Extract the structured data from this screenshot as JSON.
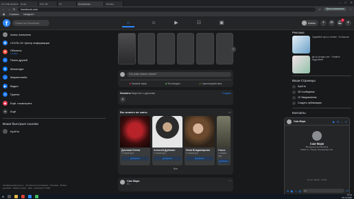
{
  "browser": {
    "tabs": [
      "(17) Vdik Facebook",
      "Gmail",
      "ГОС VIP",
      "VK",
      "YouTube",
      "Telegram",
      "LOL Sell"
    ],
    "active_tab": "(3) Facebook",
    "url": "facebook.com",
    "profile": "Приостановлено",
    "bookmarks": [
      "Сервисы",
      "Instagram"
    ]
  },
  "fb": {
    "logo": "f",
    "search_placeholder": "Поиск на Facebook",
    "nav_tabs": [
      "home-icon",
      "friends-icon",
      "watch-icon",
      "groups-icon",
      "gaming-icon"
    ],
    "me_name": "Алекс",
    "notif_count": "3"
  },
  "left": {
    "items": [
      {
        "label": "Алекс Алексеев",
        "icon": "avatar",
        "color": "#888888"
      },
      {
        "label": "COVID-19: Центр информации",
        "icon": "covid-icon",
        "color": "#2d88ff"
      },
      {
        "label": "Объекты",
        "sub": "1 новое",
        "icon": "pages-icon",
        "color": "#f5533d"
      },
      {
        "label": "Поиск друзей",
        "icon": "friends-icon",
        "color": "#1877f2"
      },
      {
        "label": "Messenger",
        "icon": "messenger-icon",
        "color": "#0a7cff"
      },
      {
        "label": "Маркетплейс",
        "icon": "marketplace-icon",
        "color": "#1877f2"
      },
      {
        "label": "Видео",
        "icon": "watch-icon",
        "color": "#1877f2"
      },
      {
        "label": "Группы",
        "icon": "groups-icon",
        "color": "#1877f2"
      },
      {
        "label": "Ещё. посмотреть",
        "icon": "events-icon",
        "color": "#f3425f"
      },
      {
        "label": "Ещё",
        "icon": "more-icon",
        "color": "#3a3b3c"
      }
    ],
    "shortcuts_heading": "Ваши быстрые ссылки",
    "shortcut": "Kyrill.fo",
    "footer": "Конфиденциальность · Условия использования · Реклама · Выбор рекламы · Файлы cookie · Ещё · Facebook © 2020"
  },
  "center": {
    "composer_placeholder": "Что у вас нового, Алекс?",
    "composer_actions": [
      "Прямой эфир",
      "Фото/видео",
      "Чувства/действия"
    ],
    "rooms_title": "Комнаты",
    "rooms_sub": "Видеочат с друзьями",
    "rooms_link": "Создать",
    "pymk_title": "Вы можете их знать",
    "people": [
      {
        "name": "Доклова Елена",
        "mutual": "1 общий друг",
        "add": "Добавить",
        "color": "#5a1a16"
      },
      {
        "name": "Алексей Дубинин",
        "mutual": "1 общий друг",
        "add": "Добавить",
        "color": "#d9d9d9"
      },
      {
        "name": "Инна Владимирова",
        "mutual": "1 общий друг",
        "add": "Добавить",
        "color": "#4a3a2a"
      },
      {
        "name": "Гонсо",
        "mutual": "1 общий друг",
        "add": "Добавить",
        "color": "#6a6a5a"
      }
    ],
    "pymk_all": "Все",
    "post_author": "Сам Марк",
    "post_time": "9 ч."
  },
  "right": {
    "ads_heading": "Реклама",
    "ads": [
      {
        "text": "Сдавайте путь к техник · 5 классов",
        "color": "#6aa0c8"
      },
      {
        "text": "qjs.vu-dvuge.com · Узнайте подробнее",
        "color": "#8ec2a7"
      }
    ],
    "pages_heading": "Ваши Страницы",
    "pages": [
      "Kyrill.fo",
      "28 Сообщения",
      "10 Уведомления",
      "Создать публикацию"
    ],
    "contacts_heading": "Контакты"
  },
  "chat": {
    "name": "Сам Марк",
    "bname": "Сам Марк",
    "sub1": "Вы друзья на Facebook",
    "sub2": "Живёт в г. Пенза, Пензенская обл.",
    "time": "18 окт. 2020 г., 16:25",
    "input_placeholder": "Aa"
  },
  "taskbar": {
    "time": "16:14",
    "date": "18.10.2020"
  }
}
